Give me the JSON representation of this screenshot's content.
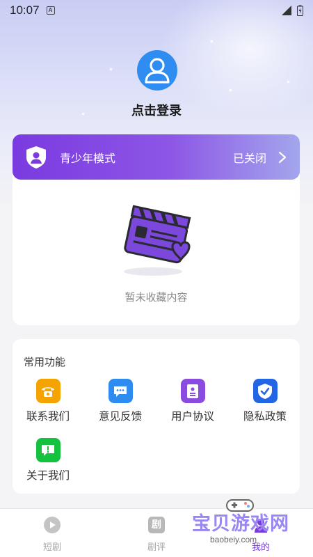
{
  "status_bar": {
    "time": "10:07",
    "badge": "A"
  },
  "profile": {
    "login_text": "点击登录"
  },
  "youth_mode": {
    "title": "青少年模式",
    "status": "已关闭"
  },
  "favorites": {
    "empty_text": "暂未收藏内容"
  },
  "functions": {
    "title": "常用功能",
    "items": [
      {
        "label": "联系我们",
        "icon": "phone-icon",
        "color": "#f5a300"
      },
      {
        "label": "意见反馈",
        "icon": "chat-icon",
        "color": "#2e8bf0"
      },
      {
        "label": "用户协议",
        "icon": "document-icon",
        "color": "#8a4be0"
      },
      {
        "label": "隐私政策",
        "icon": "shield-check-icon",
        "color": "#2266e6"
      },
      {
        "label": "关于我们",
        "icon": "info-bubble-icon",
        "color": "#15c23f"
      }
    ]
  },
  "tabbar": {
    "tabs": [
      {
        "label": "短剧",
        "icon": "play-icon"
      },
      {
        "label": "剧评",
        "icon": "review-icon",
        "glyph": "剧"
      },
      {
        "label": "我的",
        "icon": "profile-icon"
      }
    ]
  },
  "watermark": {
    "text": "宝贝游戏网",
    "url": "baobeiy.com"
  },
  "colors": {
    "accent": "#7a3ae0",
    "avatar": "#2f8cf0",
    "background": "#f4f4f6"
  }
}
